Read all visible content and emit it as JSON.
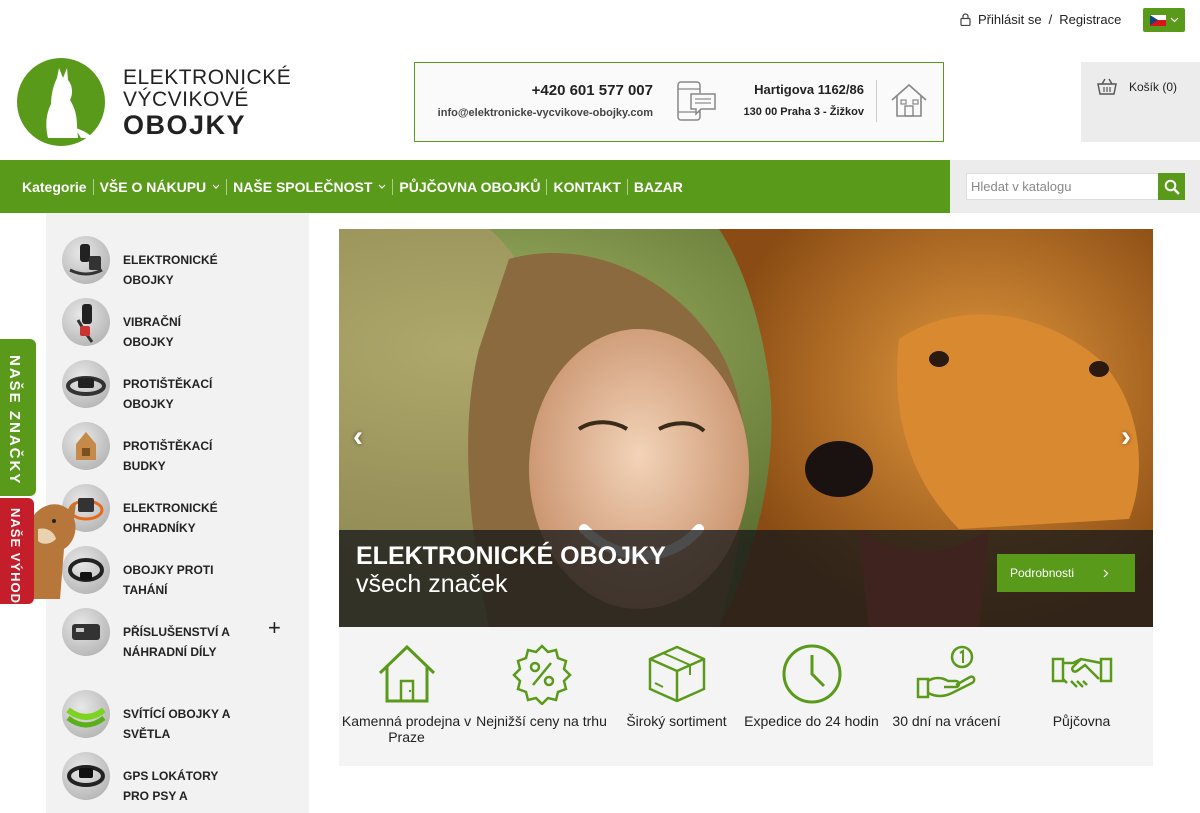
{
  "topbar": {
    "login": "Přihlásit se",
    "separator": "/",
    "register": "Registrace",
    "language_flag": "cz-flag-icon"
  },
  "logo": {
    "line1": "ELEKTRONICKÉ",
    "line2": "VÝCVIKOVÉ",
    "line3": "OBOJKY",
    "accent_color": "#5a9a1b"
  },
  "contact": {
    "phone": "+420 601 577 007",
    "email": "info@elektronicke-vycvikove-obojky.com",
    "address_line1": "Hartigova 1162/86",
    "address_line2": "130 00 Praha 3 - Žižkov"
  },
  "cart": {
    "label": "Košík (0)"
  },
  "nav": {
    "items": [
      {
        "label": "Kategorie",
        "dropdown": false
      },
      {
        "label": "VŠE O NÁKUPU",
        "dropdown": true
      },
      {
        "label": "NAŠE SPOLEČNOST",
        "dropdown": true
      },
      {
        "label": "PŮJČOVNA OBOJKŮ",
        "dropdown": false
      },
      {
        "label": "KONTAKT",
        "dropdown": false
      },
      {
        "label": "BAZAR",
        "dropdown": false
      }
    ]
  },
  "search": {
    "placeholder": "Hledat v katalogu"
  },
  "sidebar": {
    "items": [
      {
        "label": "ELEKTRONICKÉ OBOJKY"
      },
      {
        "label": "VIBRAČNÍ OBOJKY"
      },
      {
        "label": "PROTIŠTĚKACÍ OBOJKY"
      },
      {
        "label": "PROTIŠTĚKACÍ BUDKY"
      },
      {
        "label": "ELEKTRONICKÉ OHRADNÍKY"
      },
      {
        "label": "OBOJKY PROTI TAHÁNÍ"
      },
      {
        "label": "PŘÍSLUŠENSTVÍ A NÁHRADNÍ DÍLY"
      },
      {
        "label": "SVÍTÍCÍ OBOJKY A SVĚTLA"
      },
      {
        "label": "GPS LOKÁTORY PRO PSY A"
      }
    ],
    "expand_symbol": "+"
  },
  "side_tabs": {
    "brands": "NAŠE ZNAČKY",
    "advantages": "NAŠE VÝHODY"
  },
  "slider": {
    "title": "ELEKTRONICKÉ OBOJKY",
    "subtitle": "všech značek",
    "button": "Podrobnosti",
    "prev": "‹",
    "next": "›"
  },
  "benefits": [
    {
      "label": "Kamenná prodejna v Praze",
      "icon": "house-icon"
    },
    {
      "label": "Nejnižší ceny na trhu",
      "icon": "percent-badge-icon"
    },
    {
      "label": "Široký sortiment",
      "icon": "box-icon"
    },
    {
      "label": "Expedice do 24 hodin",
      "icon": "clock-icon"
    },
    {
      "label": "30 dní na vrácení",
      "icon": "hand-coin-icon"
    },
    {
      "label": "Půjčovna",
      "icon": "handshake-icon"
    }
  ],
  "colors": {
    "green": "#5a9a1b",
    "red": "#c41e2b",
    "gray": "#f2f2f2"
  }
}
